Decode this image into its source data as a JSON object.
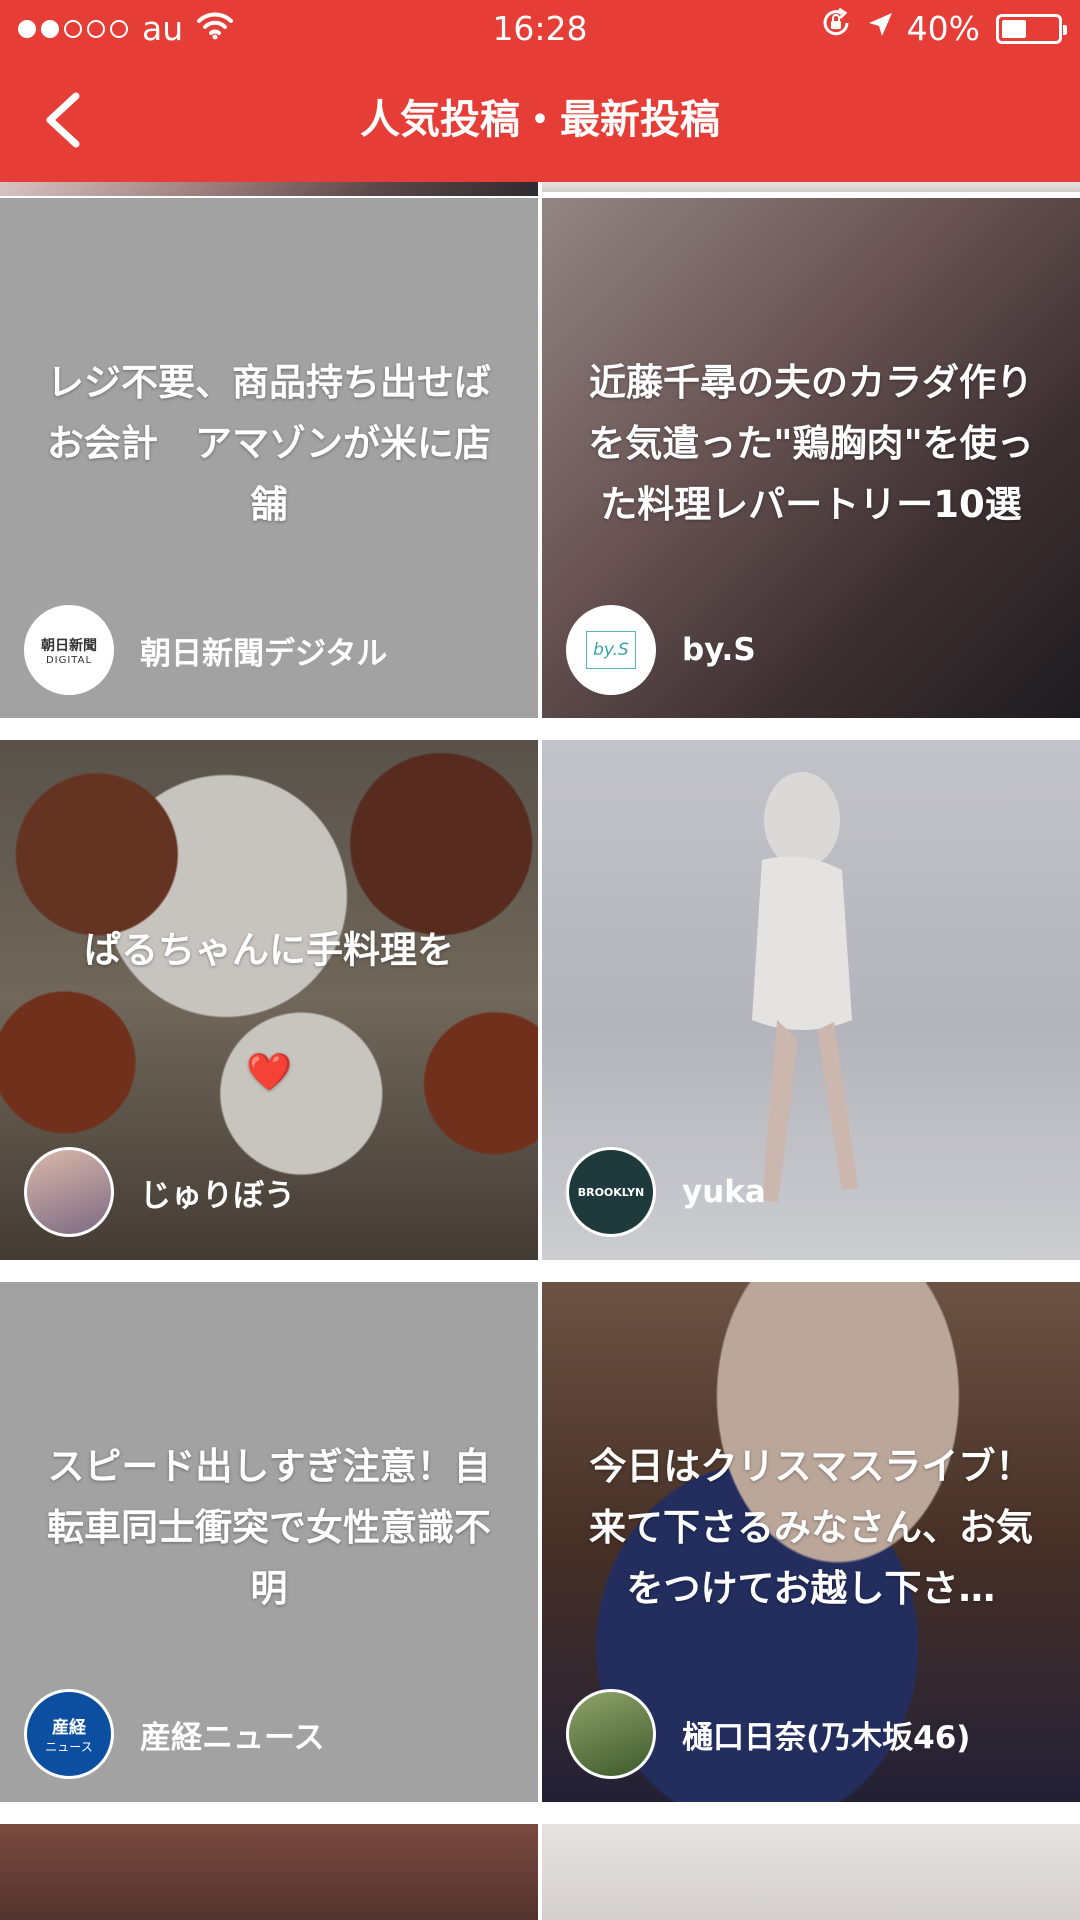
{
  "status_bar": {
    "carrier": "au",
    "time": "16:28",
    "battery": "40%",
    "battery_level": 0.4,
    "signal_bars_on": 2,
    "signal_bars_total": 5
  },
  "nav": {
    "title": "人気投稿・最新投稿",
    "accent_color": "#e63d37"
  },
  "posts": [
    {
      "caption": "レジ不要、商品持ち出せばお会計　アマゾンが米に店舗",
      "author": "朝日新聞デジタル",
      "avatar_text": "朝日新聞",
      "avatar_subtext": "DIGITAL"
    },
    {
      "caption": "近藤千尋の夫のカラダ作りを気遣った\"鶏胸肉\"を使った料理レパートリー10選",
      "author": "by.S",
      "avatar_text": "by.S"
    },
    {
      "caption": "ぱるちゃんに手料理を",
      "caption_emoji": "❤️",
      "author": "じゅりぼう"
    },
    {
      "caption": "",
      "author": "yuka",
      "avatar_text": "BROOKLYN"
    },
    {
      "caption": "スピード出しすぎ注意！自転車同士衝突で女性意識不明",
      "author": "産経ニュース",
      "avatar_text": "産経",
      "avatar_subtext": "ニュース"
    },
    {
      "caption": "今日はクリスマスライブ！\n来て下さるみなさん、お気をつけてお越し下さ…",
      "author": "樋口日奈(乃木坂46)"
    }
  ]
}
